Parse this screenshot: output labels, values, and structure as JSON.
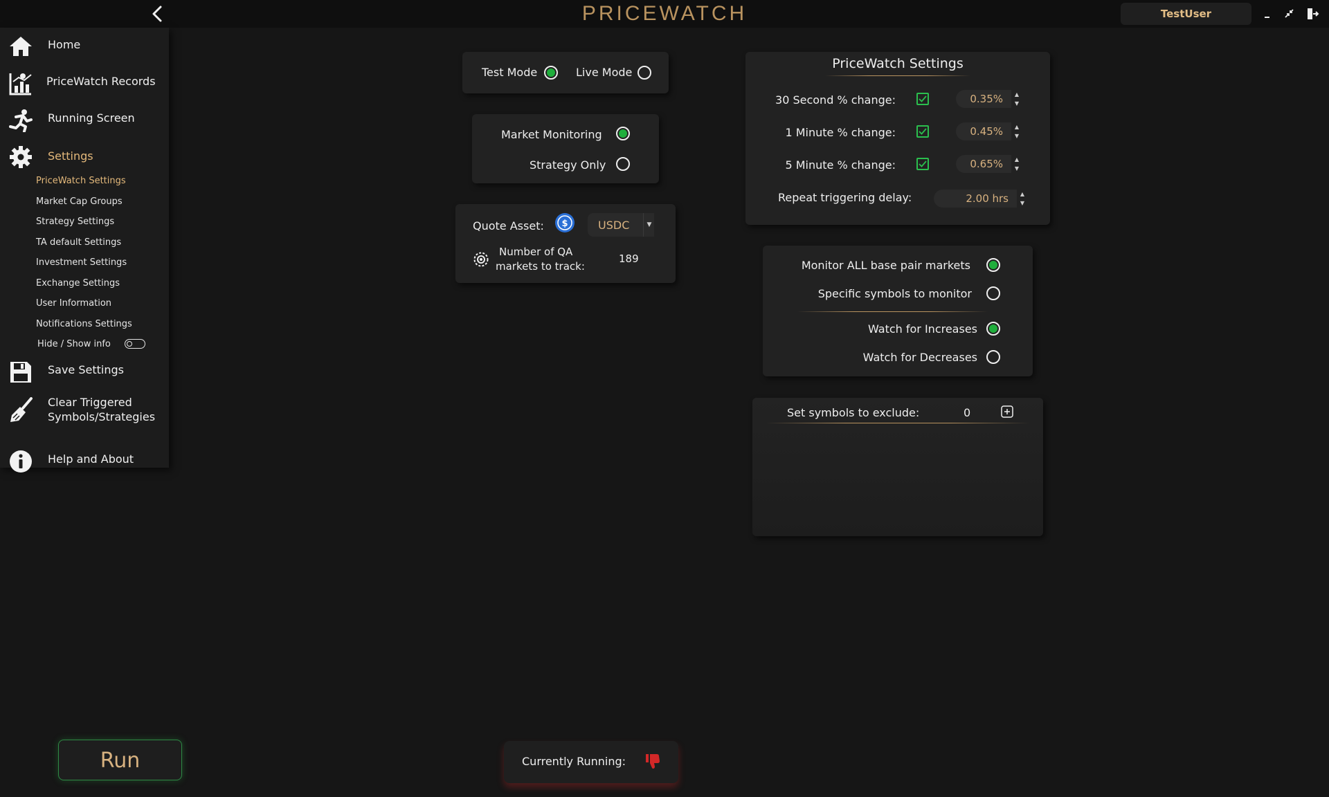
{
  "app": {
    "title": "PRICEWATCH",
    "username": "TestUser"
  },
  "sidebar": {
    "items": [
      {
        "label": "Home",
        "icon": "home-icon"
      },
      {
        "label": "PriceWatch Records",
        "icon": "records-chart-icon"
      },
      {
        "label": "Running Screen",
        "icon": "running-man-icon"
      },
      {
        "label": "Settings",
        "icon": "gear-icon",
        "active": true
      }
    ],
    "sub_items": [
      {
        "label": "PriceWatch Settings",
        "active": true
      },
      {
        "label": "Market Cap Groups"
      },
      {
        "label": "Strategy Settings"
      },
      {
        "label": "TA default Settings"
      },
      {
        "label": "Investment Settings"
      },
      {
        "label": "Exchange Settings"
      },
      {
        "label": "User Information"
      },
      {
        "label": "Notifications Settings"
      }
    ],
    "hide_show_info": {
      "label": "Hide / Show info",
      "on": false
    },
    "bottom_items": [
      {
        "label": "Save Settings",
        "icon": "save-icon"
      },
      {
        "label_line1": "Clear Triggered",
        "label_line2": "Symbols/Strategies",
        "icon": "broom-icon"
      },
      {
        "label": "Help and About",
        "icon": "info-icon"
      }
    ]
  },
  "mode": {
    "test_label": "Test Mode",
    "live_label": "Live Mode",
    "selected": "test"
  },
  "monitoring": {
    "market_label": "Market Monitoring",
    "strategy_label": "Strategy Only",
    "selected": "market"
  },
  "quote": {
    "label": "Quote Asset:",
    "asset": "USDC",
    "markets_label_line1": "Number of QA",
    "markets_label_line2": "markets to track:",
    "markets_count": "189"
  },
  "settings": {
    "title": "PriceWatch Settings",
    "rows": [
      {
        "label": "30 Second % change:",
        "checked": true,
        "value": "0.35%"
      },
      {
        "label": "1 Minute % change:",
        "checked": true,
        "value": "0.45%"
      },
      {
        "label": "5 Minute % change:",
        "checked": true,
        "value": "0.65%"
      }
    ],
    "delay_label": "Repeat triggering delay:",
    "delay_value": "2.00 hrs"
  },
  "watch": {
    "monitor_all_label": "Monitor ALL base pair markets",
    "specific_label": "Specific symbols to monitor",
    "market_selected": "all",
    "increases_label": "Watch for Increases",
    "decreases_label": "Watch for Decreases",
    "direction_selected": "increases"
  },
  "exclude": {
    "label": "Set symbols to exclude:",
    "count": "0"
  },
  "run": {
    "label": "Run"
  },
  "status": {
    "label": "Currently Running:",
    "running": false
  },
  "colors": {
    "accent": "#e4b97b",
    "title": "#b9935f",
    "active_green": "#1fae3c",
    "stop_red": "#d32828"
  }
}
